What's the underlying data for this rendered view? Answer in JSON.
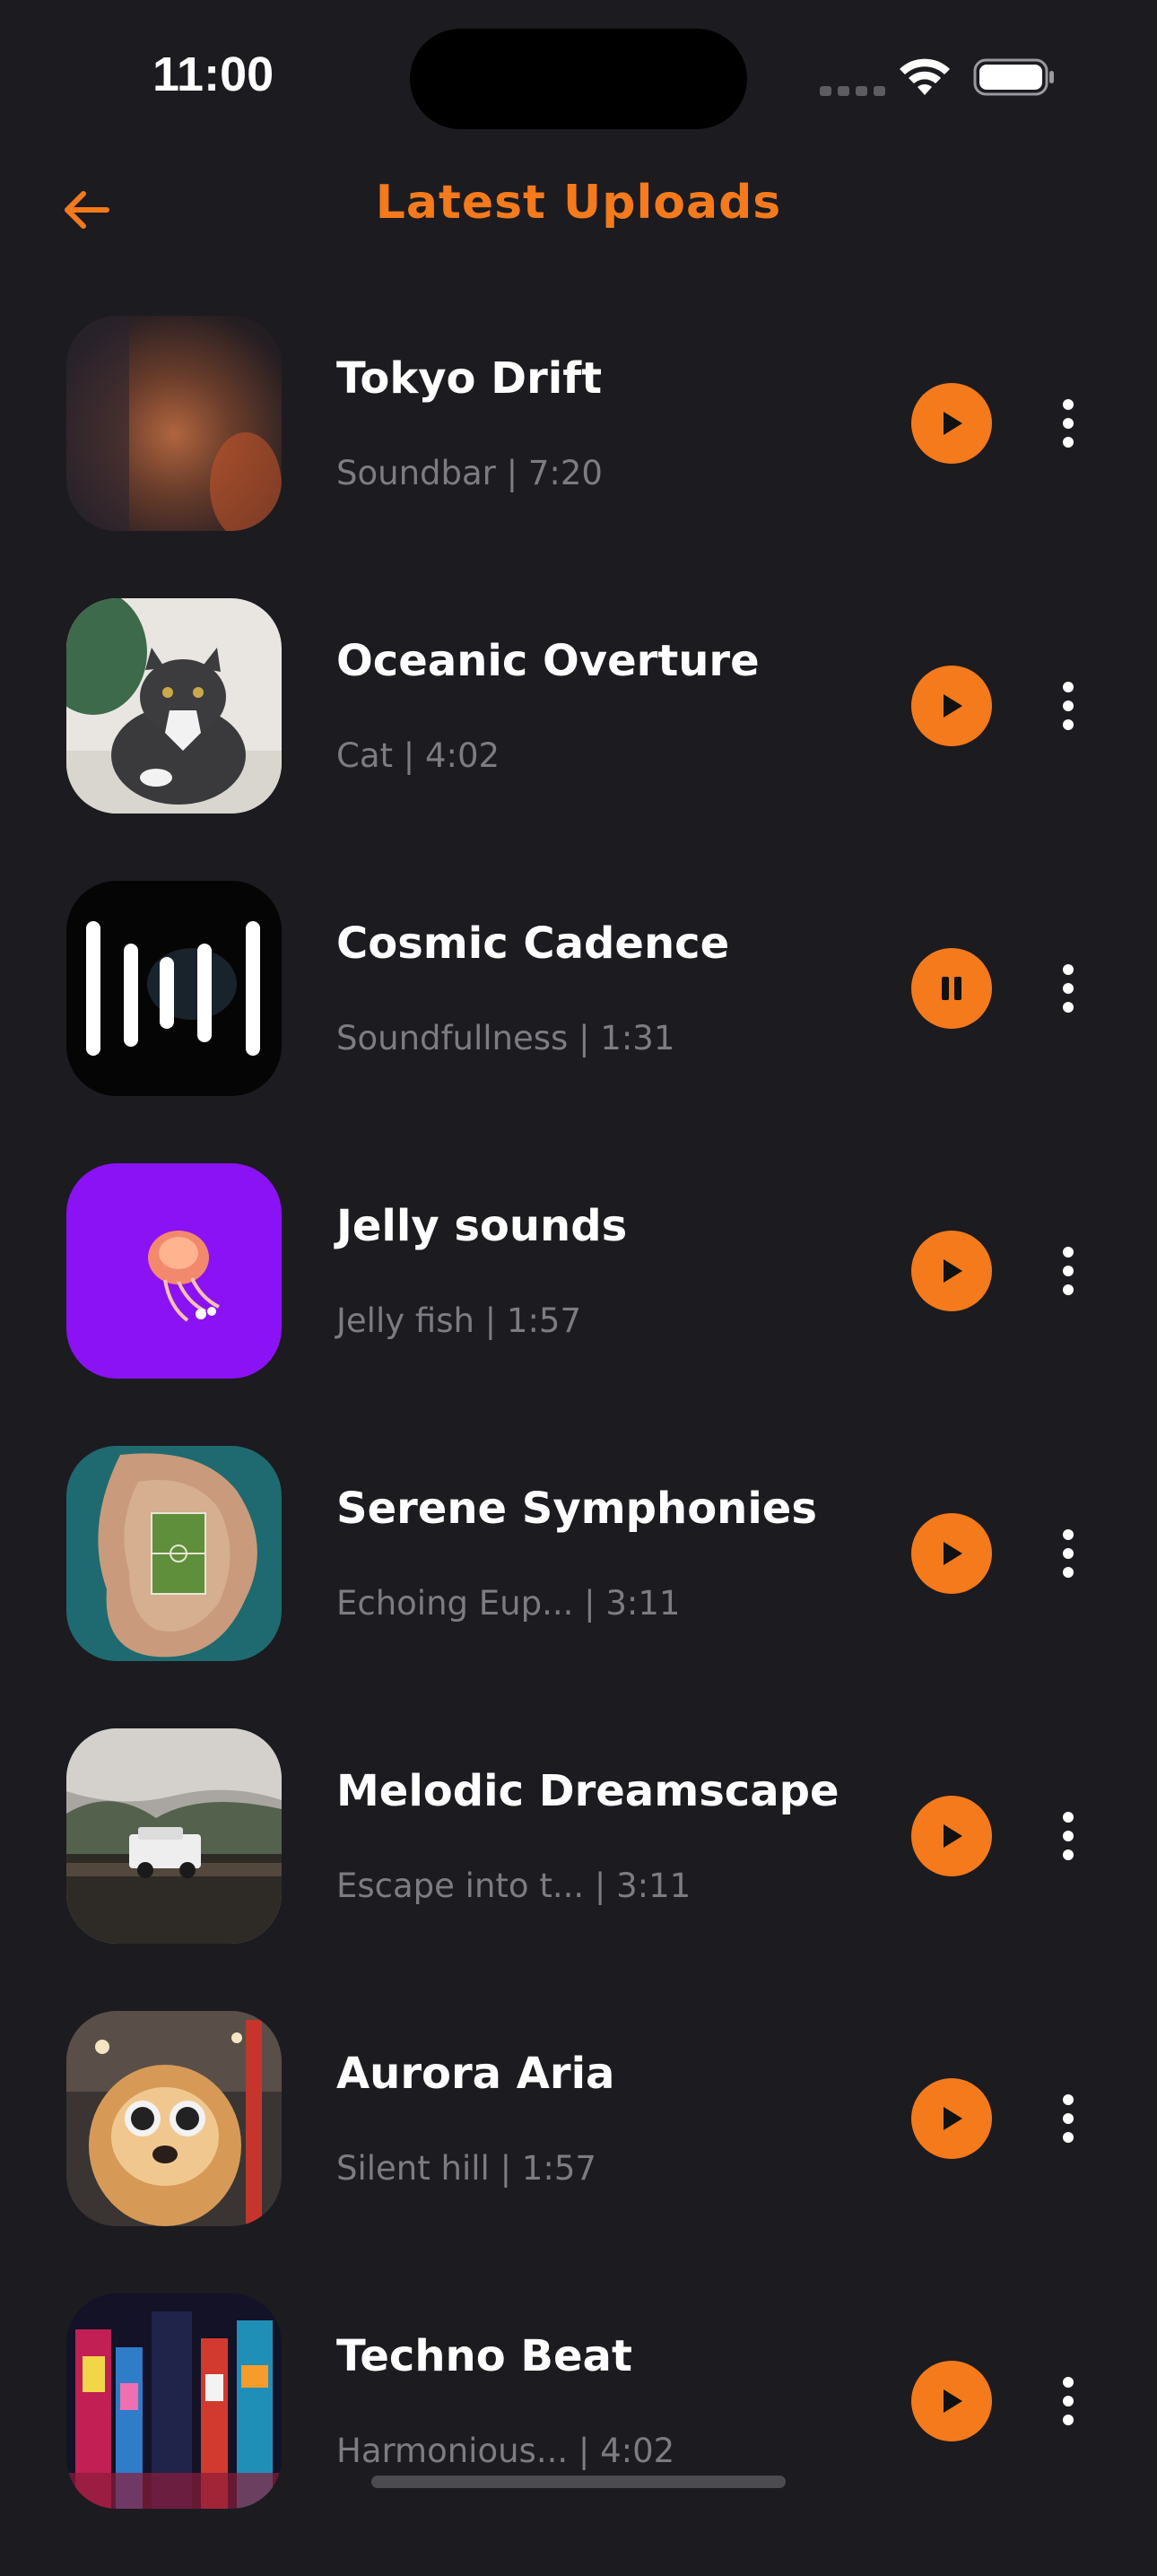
{
  "status_bar": {
    "time": "11:00"
  },
  "header": {
    "title": "Latest Uploads",
    "back_icon": "arrow-left-icon"
  },
  "colors": {
    "background": "#1c1b20",
    "accent": "#f47a1b",
    "primary_text": "#ffffff",
    "secondary_text": "#7d7c82"
  },
  "tracks": [
    {
      "title": "Tokyo Drift",
      "meta": "Soundbar | 7:20",
      "state": "play"
    },
    {
      "title": "Oceanic Overture",
      "meta": "Cat | 4:02",
      "state": "play"
    },
    {
      "title": "Cosmic Cadence",
      "meta": "Soundfullness | 1:31",
      "state": "pause"
    },
    {
      "title": "Jelly sounds",
      "meta": "Jelly fish | 1:57",
      "state": "play"
    },
    {
      "title": "Serene Symphonies",
      "meta": "Echoing Eup... | 3:11",
      "state": "play"
    },
    {
      "title": "Melodic Dreamscape",
      "meta": "Escape into t... | 3:11",
      "state": "play"
    },
    {
      "title": "Aurora Aria",
      "meta": "Silent hill | 1:57",
      "state": "play"
    },
    {
      "title": "Techno Beat",
      "meta": "Harmonious... | 4:02",
      "state": "play"
    }
  ]
}
